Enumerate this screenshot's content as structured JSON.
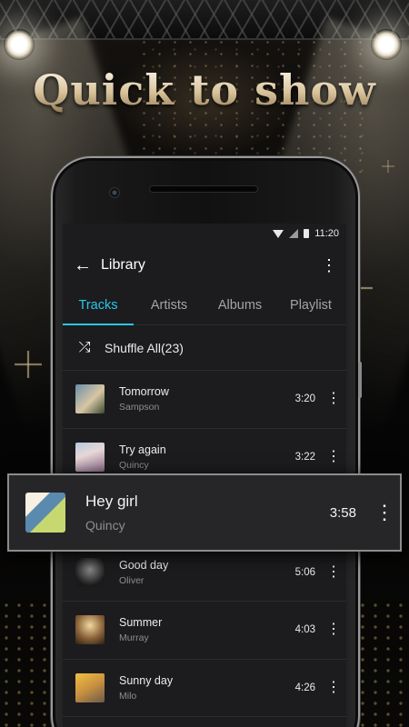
{
  "promo": {
    "headline": "Quick to show"
  },
  "statusbar": {
    "time": "11:20",
    "icons": [
      "wifi-icon",
      "signal-icon",
      "battery-icon"
    ]
  },
  "appbar": {
    "back_icon": "arrow-left-icon",
    "title": "Library",
    "menu_icon": "more-vertical-icon"
  },
  "tabs": [
    {
      "label": "Tracks",
      "active": true
    },
    {
      "label": "Artists",
      "active": false
    },
    {
      "label": "Albums",
      "active": false
    },
    {
      "label": "Playlist",
      "active": false
    }
  ],
  "shuffle": {
    "icon": "shuffle-icon",
    "label": "Shuffle All(23)"
  },
  "tracks": [
    {
      "name": "Tomorrow",
      "artist": "Sampson",
      "duration": "3:20"
    },
    {
      "name": "Try again",
      "artist": "Quincy",
      "duration": "3:22"
    },
    {
      "name": "",
      "artist": "",
      "duration": ""
    },
    {
      "name": "Good day",
      "artist": "Oliver",
      "duration": "5:06"
    },
    {
      "name": "Summer",
      "artist": "Murray",
      "duration": "4:03"
    },
    {
      "name": "Sunny day",
      "artist": "Milo",
      "duration": "4:26"
    }
  ],
  "highlight": {
    "name": "Hey girl",
    "artist": "Quincy",
    "duration": "3:58"
  },
  "colors": {
    "accent": "#29c6e8",
    "background": "#1c1c1e",
    "divider": "#2c2c2e"
  }
}
